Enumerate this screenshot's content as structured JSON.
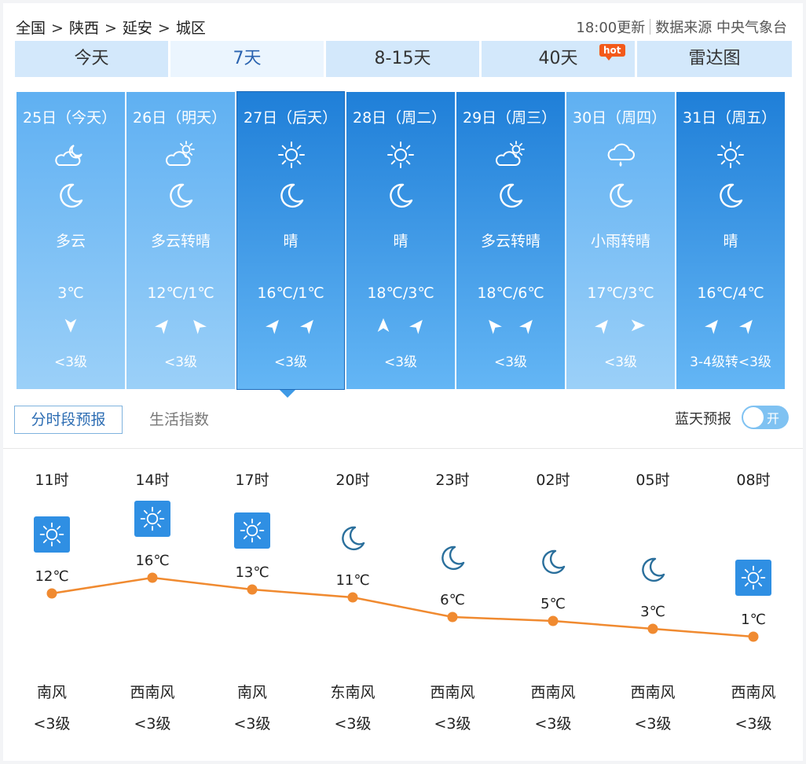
{
  "breadcrumb": [
    "全国",
    "陕西",
    "延安",
    "城区"
  ],
  "breadcrumb_sep": ">",
  "update_time": "18:00更新",
  "data_source": "数据来源 中央气象台",
  "tabs": [
    {
      "label": "今天"
    },
    {
      "label": "7天",
      "active": true
    },
    {
      "label": "8-15天"
    },
    {
      "label": "40天",
      "badge": "hot"
    },
    {
      "label": "雷达图"
    }
  ],
  "colors": {
    "day_panel_light": "#64b6f5",
    "day_panel_dark": "#1f7fd8",
    "temp_line": "#f08a30",
    "sun_tile": "#2f8fe3"
  },
  "days": [
    {
      "date": "25日（今天）",
      "icon_day": "partly-cloudy-night-icon",
      "icon_night": "moon-icon",
      "desc": "多云",
      "temp": "3℃",
      "wind_icons": [
        "arrow-down-icon"
      ],
      "wind_level": "<3级",
      "style": "light"
    },
    {
      "date": "26日（明天）",
      "icon_day": "partly-cloudy-icon",
      "icon_night": "moon-icon",
      "desc": "多云转晴",
      "temp": "12℃/1℃",
      "wind_icons": [
        "arrow-ne-icon",
        "arrow-nw-icon"
      ],
      "wind_level": "<3级",
      "style": "light"
    },
    {
      "date": "27日（后天）",
      "icon_day": "sun-icon",
      "icon_night": "moon-icon",
      "desc": "晴",
      "temp": "16℃/1℃",
      "wind_icons": [
        "arrow-ne-icon",
        "arrow-ne-icon"
      ],
      "wind_level": "<3级",
      "style": "dark",
      "selected": true
    },
    {
      "date": "28日（周二）",
      "icon_day": "sun-icon",
      "icon_night": "moon-icon",
      "desc": "晴",
      "temp": "18℃/3℃",
      "wind_icons": [
        "arrow-up-icon",
        "arrow-ne-icon"
      ],
      "wind_level": "<3级",
      "style": "dark"
    },
    {
      "date": "29日（周三）",
      "icon_day": "partly-cloudy-icon",
      "icon_night": "moon-icon",
      "desc": "多云转晴",
      "temp": "18℃/6℃",
      "wind_icons": [
        "arrow-nw-icon",
        "arrow-ne-icon"
      ],
      "wind_level": "<3级",
      "style": "dark"
    },
    {
      "date": "30日（周四）",
      "icon_day": "light-rain-icon",
      "icon_night": "moon-icon",
      "desc": "小雨转晴",
      "temp": "17℃/3℃",
      "wind_icons": [
        "arrow-ne-icon",
        "arrow-right-icon"
      ],
      "wind_level": "<3级",
      "style": "light"
    },
    {
      "date": "31日（周五）",
      "icon_day": "sun-icon",
      "icon_night": "moon-icon",
      "desc": "晴",
      "temp": "16℃/4℃",
      "wind_icons": [
        "arrow-ne-icon",
        "arrow-ne-icon"
      ],
      "wind_level": "3-4级转<3级",
      "style": "dark"
    }
  ],
  "subtabs": {
    "hourly": "分时段预报",
    "life": "生活指数"
  },
  "bluesky": {
    "label": "蓝天预报",
    "toggle": "开"
  },
  "hourly": [
    {
      "time": "11时",
      "icon": "sun-icon",
      "temp": 12,
      "temp_label": "12℃",
      "wind_dir": "南风",
      "wind_level": "<3级"
    },
    {
      "time": "14时",
      "icon": "sun-icon",
      "temp": 16,
      "temp_label": "16℃",
      "wind_dir": "西南风",
      "wind_level": "<3级"
    },
    {
      "time": "17时",
      "icon": "sun-icon",
      "temp": 13,
      "temp_label": "13℃",
      "wind_dir": "南风",
      "wind_level": "<3级"
    },
    {
      "time": "20时",
      "icon": "moon-icon",
      "temp": 11,
      "temp_label": "11℃",
      "wind_dir": "东南风",
      "wind_level": "<3级"
    },
    {
      "time": "23时",
      "icon": "moon-icon",
      "temp": 6,
      "temp_label": "6℃",
      "wind_dir": "西南风",
      "wind_level": "<3级"
    },
    {
      "time": "02时",
      "icon": "moon-icon",
      "temp": 5,
      "temp_label": "5℃",
      "wind_dir": "西南风",
      "wind_level": "<3级"
    },
    {
      "time": "05时",
      "icon": "moon-icon",
      "temp": 3,
      "temp_label": "3℃",
      "wind_dir": "西南风",
      "wind_level": "<3级"
    },
    {
      "time": "08时",
      "icon": "sun-icon",
      "temp": 1,
      "temp_label": "1℃",
      "wind_dir": "西南风",
      "wind_level": "<3级"
    }
  ]
}
